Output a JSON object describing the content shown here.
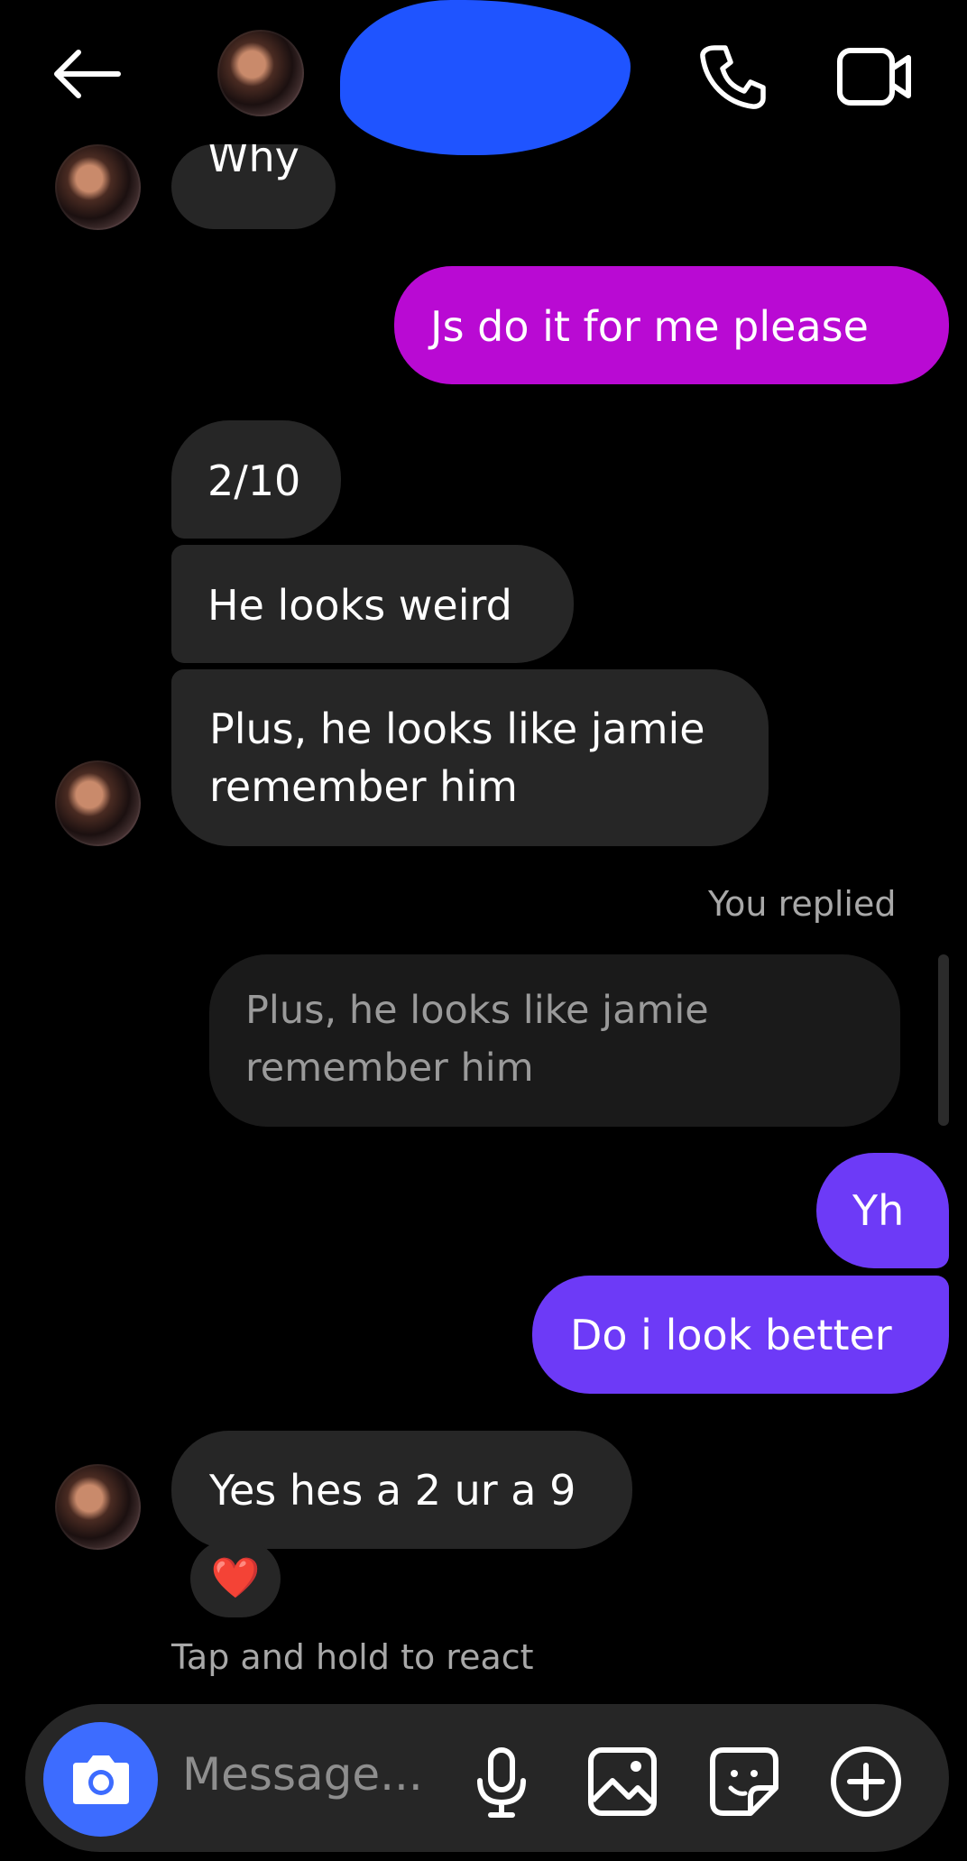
{
  "header": {
    "back_icon": "arrow-left-icon",
    "call_icon": "phone-icon",
    "video_icon": "video-camera-icon"
  },
  "messages": {
    "m1": "Why",
    "m2": "Js do it for me please",
    "m3": "2/10",
    "m4": "He looks weird",
    "m5a": "Plus, he looks like jamie",
    "m5b": "remember  him",
    "you_replied": "You replied",
    "quote_a": "Plus, he looks like jamie",
    "quote_b": "remember  him",
    "m6": "Yh",
    "m7": "Do i look better",
    "m8": "Yes hes a 2 ur a 9",
    "reaction": "❤️",
    "hint": "Tap and hold to react"
  },
  "composer": {
    "placeholder": "Message...",
    "camera_icon": "camera-icon",
    "mic_icon": "microphone-icon",
    "gallery_icon": "image-icon",
    "sticker_icon": "sticker-icon",
    "plus_icon": "plus-circle-icon"
  },
  "colors": {
    "outgoing_pink": "#b90ad3",
    "outgoing_purple": "#6d3af7",
    "incoming": "#262626",
    "camera_button": "#3d6cff"
  }
}
